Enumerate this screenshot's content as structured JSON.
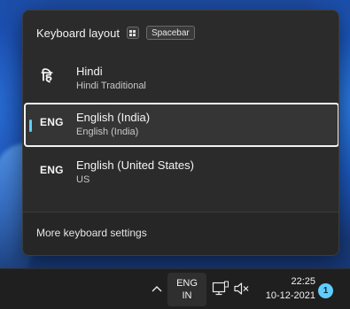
{
  "flyout": {
    "title": "Keyboard layout",
    "shortcut_key": "Spacebar",
    "items": [
      {
        "code": "हि",
        "title": "Hindi",
        "subtitle": "Hindi Traditional",
        "selected": false
      },
      {
        "code": "ENG",
        "title": "English (India)",
        "subtitle": "English (India)",
        "selected": true
      },
      {
        "code": "ENG",
        "title": "English (United States)",
        "subtitle": "US",
        "selected": false
      }
    ],
    "footer_link": "More keyboard settings"
  },
  "taskbar": {
    "chevron": "^",
    "lang_line1": "ENG",
    "lang_line2": "IN",
    "time": "22:25",
    "date": "10-12-2021",
    "notification_count": "1"
  },
  "colors": {
    "accent": "#60cdff",
    "flyout_bg": "#2b2b2b",
    "taskbar_bg": "#1f1f1f"
  },
  "icons": {
    "windows_key": "windows-key-icon",
    "network": "network-monitor-icon",
    "volume": "volume-muted-icon",
    "chevron": "chevron-up-icon"
  }
}
